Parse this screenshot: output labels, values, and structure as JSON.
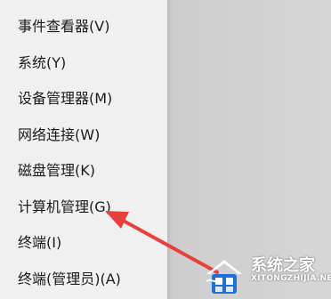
{
  "context_menu": {
    "items": [
      {
        "label": "事件查看器(V)"
      },
      {
        "label": "系统(Y)"
      },
      {
        "label": "设备管理器(M)"
      },
      {
        "label": "网络连接(W)"
      },
      {
        "label": "磁盘管理(K)"
      },
      {
        "label": "计算机管理(G)"
      },
      {
        "label": "终端(I)"
      },
      {
        "label": "终端(管理员)(A)"
      }
    ]
  },
  "annotation": {
    "arrow_color": "#e8413a",
    "points_to": "计算机管理(G)"
  },
  "watermark": {
    "title": "系统之家",
    "domain": "XITONGZHIJIA.NET",
    "logo_icon": "house-logo-icon",
    "logo_colors": [
      "#1e6fd9",
      "#ffffff"
    ]
  }
}
